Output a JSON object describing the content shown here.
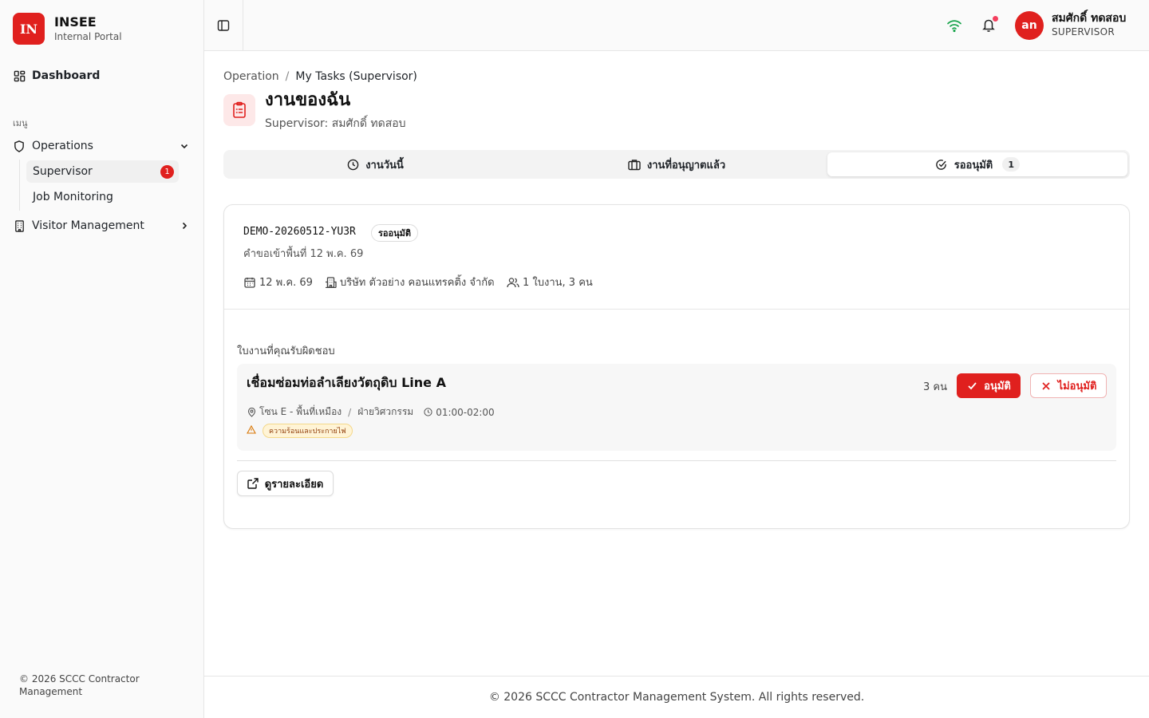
{
  "brand": {
    "logo_text": "IN",
    "name": "INSEE",
    "subtitle": "Internal Portal",
    "accent": "#e0201e"
  },
  "sidebar": {
    "dashboard_label": "Dashboard",
    "section_label": "เมนู",
    "operations_label": "Operations",
    "sub_items": [
      {
        "label": "Supervisor",
        "badge": "1"
      },
      {
        "label": "Job Monitoring"
      }
    ],
    "visitor_label": "Visitor Management",
    "footer": "© 2026 SCCC Contractor Management"
  },
  "header": {
    "avatar_initials": "an",
    "user_name": "สมศักดิ์ ทดสอบ",
    "user_role": "SUPERVISOR",
    "notification_dot_color": "#f43f5e"
  },
  "breadcrumb": {
    "parent": "Operation",
    "separator": "/",
    "current": "My Tasks (Supervisor)"
  },
  "page": {
    "title": "งานของฉัน",
    "subtitle": "Supervisor: สมศักดิ์ ทดสอบ"
  },
  "tabs": [
    {
      "label": "งานวันนี้",
      "icon": "clock-icon"
    },
    {
      "label": "งานที่อนุญาตแล้ว",
      "icon": "briefcase-icon"
    },
    {
      "label": "รออนุมัติ",
      "icon": "check-circle-icon",
      "count": "1",
      "active": true
    }
  ],
  "request": {
    "id": "DEMO-20260512-YU3R",
    "status": "รออนุมัติ",
    "description": "คำขอเข้าพื้นที่ 12 พ.ค. 69",
    "date": "12 พ.ค. 69",
    "company": "บริษัท ตัวอย่าง คอนแทรคติ้ง จำกัด",
    "summary": "1 ใบงาน, 3 คน",
    "section_label": "ใบงานที่คุณรับผิดชอบ",
    "ticket": {
      "title": "เชื่อมซ่อมท่อลำเลียงวัตถุดิบ Line A",
      "location": "โซน E - พื้นที่เหมือง",
      "department": "ฝ่ายวิศวกรรม",
      "time": "01:00-02:00",
      "hazard": "ความร้อนและประกายไฟ",
      "people": "3 คน",
      "approve_label": "อนุมัติ",
      "reject_label": "ไม่อนุมัติ"
    },
    "details_label": "ดูรายละเอียด"
  },
  "footer": "© 2026 SCCC Contractor Management System. All rights reserved."
}
